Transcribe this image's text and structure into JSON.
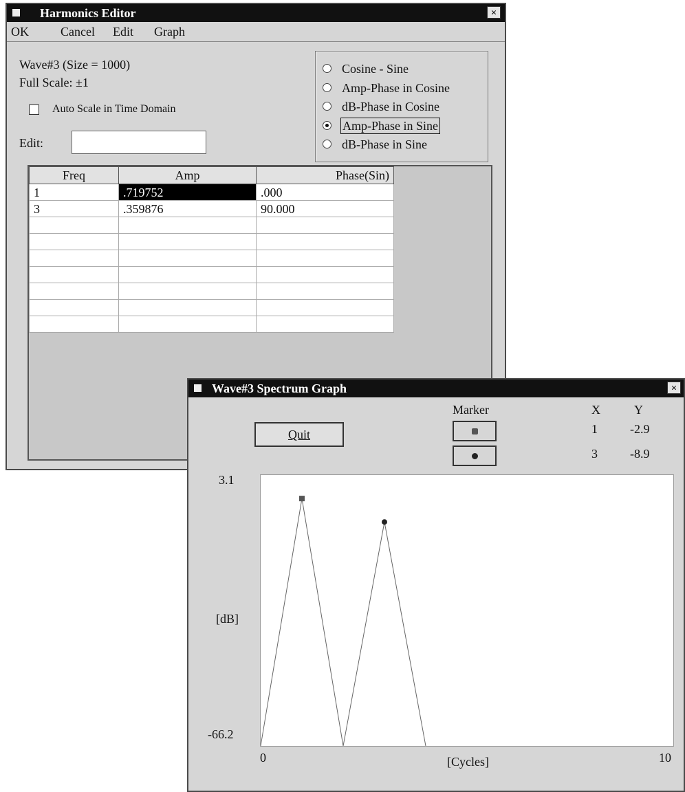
{
  "harmonics_editor": {
    "title": "Harmonics Editor",
    "close_label": "×",
    "menu": [
      "OK",
      "Cancel",
      "Edit",
      "Graph"
    ],
    "wave_info": "Wave#3 (Size = 1000)",
    "full_scale": "Full Scale: ±1",
    "auto_scale_label": "Auto Scale in Time Domain",
    "auto_scale_checked": false,
    "edit_label": "Edit:",
    "edit_value": "",
    "radio_options": [
      {
        "label": "Cosine - Sine",
        "selected": false
      },
      {
        "label": "Amp-Phase in Cosine",
        "selected": false
      },
      {
        "label": "dB-Phase in Cosine",
        "selected": false
      },
      {
        "label": "Amp-Phase in Sine",
        "selected": true
      },
      {
        "label": "dB-Phase in Sine",
        "selected": false
      }
    ],
    "table": {
      "columns": [
        "Freq",
        "Amp",
        "Phase(Sin)"
      ],
      "rows": [
        [
          "1",
          ".719752",
          ".000"
        ],
        [
          "3",
          ".359876",
          "90.000"
        ],
        [
          "",
          "",
          ""
        ],
        [
          "",
          "",
          ""
        ],
        [
          "",
          "",
          ""
        ],
        [
          "",
          "",
          ""
        ],
        [
          "",
          "",
          ""
        ],
        [
          "",
          "",
          ""
        ],
        [
          "",
          "",
          ""
        ]
      ]
    }
  },
  "spectrum_graph": {
    "title": "Wave#3 Spectrum Graph",
    "close_label": "×",
    "quit_label": "Quit",
    "marker_header": "Marker",
    "x_header": "X",
    "y_header": "Y",
    "markers": [
      {
        "x": "1",
        "y": "-2.9",
        "shape": "square"
      },
      {
        "x": "3",
        "y": "-8.9",
        "shape": "circle"
      }
    ],
    "y_max_label": "3.1",
    "y_min_label": "-66.2",
    "y_unit_label": "[dB]",
    "x_min_label": "0",
    "x_max_label": "10",
    "x_unit_label": "[Cycles]"
  },
  "chart_data": {
    "type": "line",
    "x": [
      0,
      1,
      2,
      3,
      4
    ],
    "values": [
      -66.2,
      -2.9,
      -66.2,
      -8.9,
      -66.2
    ],
    "xlabel": "[Cycles]",
    "ylabel": "[dB]",
    "xlim": [
      0,
      10
    ],
    "ylim": [
      -66.2,
      3.1
    ],
    "grid": false,
    "markers": [
      {
        "x": 1,
        "y": -2.9
      },
      {
        "x": 3,
        "y": -8.9
      }
    ]
  }
}
